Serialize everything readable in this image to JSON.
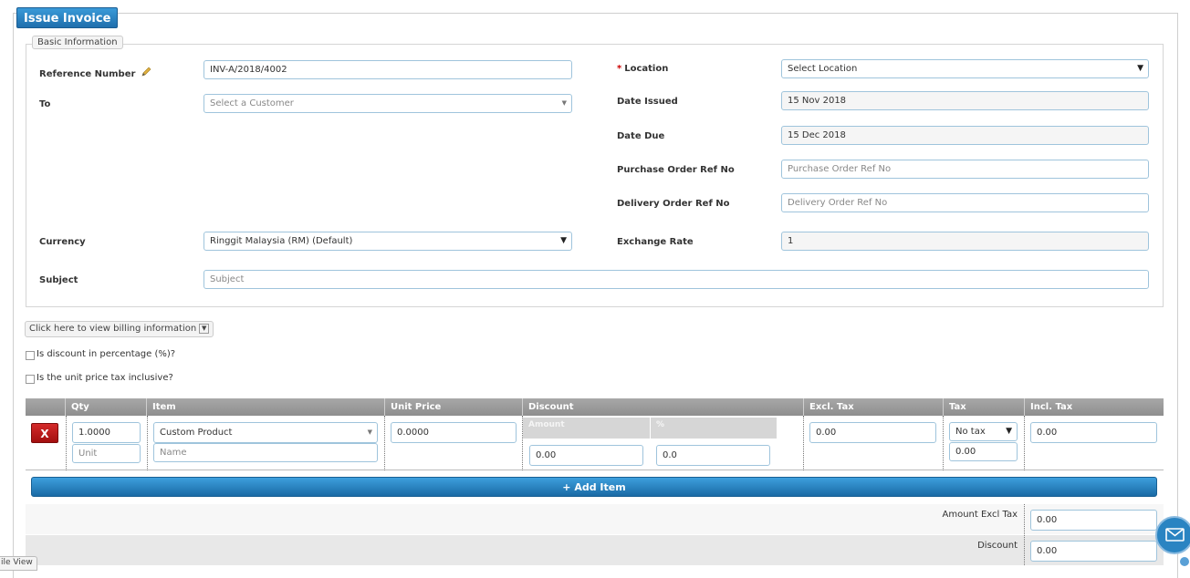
{
  "title": "Issue Invoice",
  "basic": {
    "legend": "Basic Information",
    "ref_label": "Reference Number",
    "ref_value": "INV-A/2018/4002",
    "to_label": "To",
    "to_placeholder": "Select a Customer",
    "currency_label": "Currency",
    "currency_value": "Ringgit Malaysia (RM) (Default)",
    "subject_label": "Subject",
    "subject_placeholder": "Subject",
    "location_required": "*",
    "location_label": "Location",
    "location_value": "Select Location",
    "date_issued_label": "Date Issued",
    "date_issued_value": "15 Nov 2018",
    "date_due_label": "Date Due",
    "date_due_value": "15 Dec 2018",
    "po_label": "Purchase Order Ref No",
    "po_placeholder": "Purchase Order Ref No",
    "do_label": "Delivery Order Ref No",
    "do_placeholder": "Delivery Order Ref No",
    "exchange_label": "Exchange Rate",
    "exchange_value": "1"
  },
  "billing_button": "Click here to view billing information",
  "options": {
    "discount_pct": "Is discount in percentage (%)?",
    "tax_inclusive": "Is the unit price tax inclusive?"
  },
  "table": {
    "headers": {
      "qty": "Qty",
      "item": "Item",
      "unit_price": "Unit Price",
      "discount": "Discount",
      "excl_tax": "Excl. Tax",
      "tax": "Tax",
      "incl_tax": "Incl. Tax"
    },
    "row": {
      "delete": "X",
      "qty": "1.0000",
      "unit_placeholder": "Unit",
      "item": "Custom Product",
      "name_placeholder": "Name",
      "unit_price": "0.0000",
      "discount_amount_label": "Amount",
      "discount_pct_label": "%",
      "discount_amount": "0.00",
      "discount_pct": "0.0",
      "excl_tax": "0.00",
      "tax_select": "No tax",
      "tax_value": "0.00",
      "incl_tax": "0.00"
    }
  },
  "add_item": "+ Add Item",
  "summary": {
    "amount_excl_label": "Amount Excl Tax",
    "amount_excl_value": "0.00",
    "discount_label": "Discount",
    "discount_value": "0.00"
  },
  "mobile_tab": "ile View",
  "icons": {
    "edit": "pencil-icon",
    "mail": "mail-icon",
    "help": "help-icon"
  },
  "colors": {
    "brand": "#1f6fad",
    "danger": "#a30f0f",
    "header": "#9a9a9a"
  }
}
